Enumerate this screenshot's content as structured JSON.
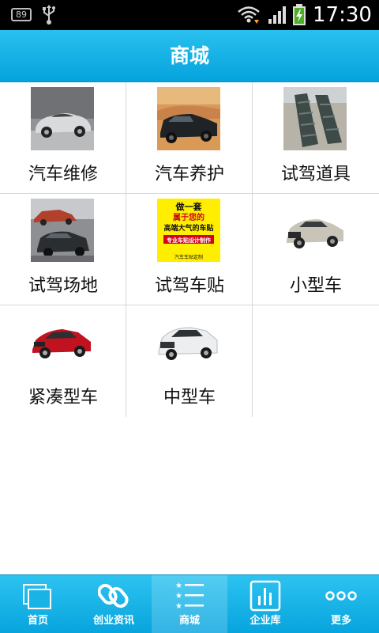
{
  "status_bar": {
    "notification_badge": "89",
    "time": "17:30",
    "icons": [
      "usb-icon",
      "wifi-icon",
      "signal-icon",
      "battery-charging-icon"
    ]
  },
  "header": {
    "title": "商城"
  },
  "grid": {
    "items": [
      {
        "label": "汽车维修",
        "image": "silver-sports-car-photo"
      },
      {
        "label": "汽车养护",
        "image": "black-suv-desert-photo"
      },
      {
        "label": "试驾道具",
        "image": "obstacle-ramps-photo"
      },
      {
        "label": "试驾场地",
        "image": "suv-test-track-photo"
      },
      {
        "label": "试驾车贴",
        "image": "car-sticker-poster",
        "poster_lines": [
          "做一套",
          "属于您的",
          "高端大气的车贴",
          "专业车贴设计制作",
          "汽车车贴定制"
        ]
      },
      {
        "label": "小型车",
        "image": "white-audi-suv-photo"
      },
      {
        "label": "紧凑型车",
        "image": "red-hatchback-photo"
      },
      {
        "label": "中型车",
        "image": "white-crossover-photo"
      }
    ]
  },
  "tabbar": {
    "active": "商城",
    "tabs": [
      {
        "label": "首页",
        "icon": "pages-icon"
      },
      {
        "label": "创业资讯",
        "icon": "chain-link-icon"
      },
      {
        "label": "商城",
        "icon": "star-list-icon"
      },
      {
        "label": "企业库",
        "icon": "bar-chart-icon"
      },
      {
        "label": "更多",
        "icon": "more-dots-icon"
      }
    ]
  },
  "colors": {
    "header_bg": "#10aee3",
    "tabbar_bg": "#10aee3",
    "grid_line": "#d8d8d8",
    "status_bg": "#000000"
  }
}
